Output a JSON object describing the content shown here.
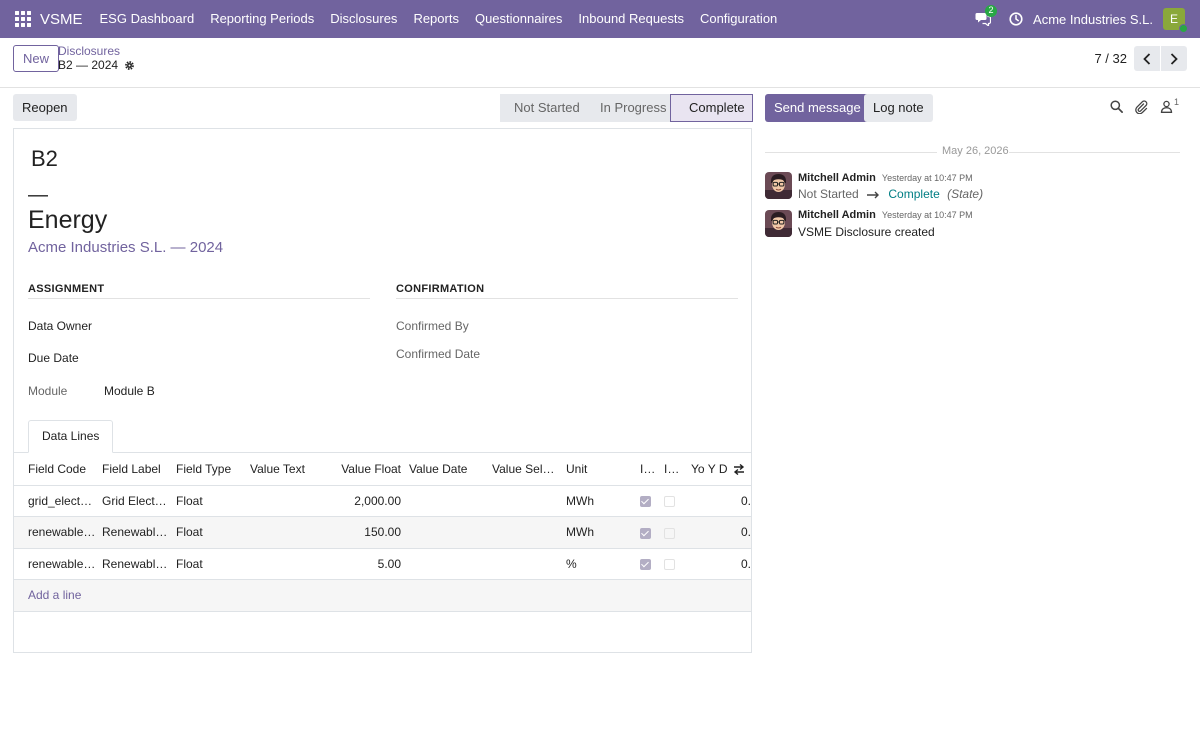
{
  "navbar": {
    "brand": "VSME",
    "menu": [
      "ESG Dashboard",
      "Reporting Periods",
      "Disclosures",
      "Reports",
      "Questionnaires",
      "Inbound Requests",
      "Configuration"
    ],
    "chat_badge": "2",
    "company": "Acme Industries S.L.",
    "avatar_initial": "E",
    "colors": {
      "navbar_bg": "#71639e",
      "online": "#28a745"
    }
  },
  "control": {
    "new_label": "New",
    "breadcrumb_parent": "Disclosures",
    "breadcrumb_current": "B2 — 2024",
    "pager_value": "7 / 32"
  },
  "actions": {
    "reopen_label": "Reopen",
    "stages": [
      "Not Started",
      "In Progress",
      "Complete"
    ],
    "active_stage": "Complete"
  },
  "form": {
    "record_name": "B2",
    "dash": "—",
    "title": "Energy",
    "subtitle": "Acme Industries S.L. — 2024",
    "assignment_title": "ASSIGNMENT",
    "confirmation_title": "CONFIRMATION",
    "data_owner_label": "Data Owner",
    "due_date_label": "Due Date",
    "module_label": "Module",
    "module_value": "Module B",
    "confirmed_by_label": "Confirmed By",
    "confirmed_date_label": "Confirmed Date",
    "tab_label": "Data Lines",
    "columns": [
      "Field Code",
      "Field Label",
      "Field Type",
      "Value Text",
      "Value Float",
      "Value Date",
      "Value Sel…",
      "Unit",
      "I…",
      "I…",
      "Yo Y D"
    ],
    "rows": [
      {
        "code": "grid_elect…",
        "label": "Grid Elect…",
        "type": "Float",
        "value_float": "2,000.00",
        "unit": "MWh",
        "c1": true,
        "c2": false,
        "yoy": "0."
      },
      {
        "code": "renewable…",
        "label": "Renewabl…",
        "type": "Float",
        "value_float": "150.00",
        "unit": "MWh",
        "c1": true,
        "c2": false,
        "yoy": "0."
      },
      {
        "code": "renewable…",
        "label": "Renewabl…",
        "type": "Float",
        "value_float": "5.00",
        "unit": "%",
        "c1": true,
        "c2": false,
        "yoy": "0."
      }
    ],
    "add_line": "Add a line"
  },
  "chatter": {
    "send_label": "Send message",
    "log_label": "Log note",
    "follower_count": "1",
    "date_separator": "May 26, 2026",
    "messages": [
      {
        "author": "Mitchell Admin",
        "time": "Yesterday at 10:47 PM",
        "old_value": "Not Started",
        "new_value": "Complete",
        "field": "(State)"
      },
      {
        "author": "Mitchell Admin",
        "time": "Yesterday at 10:47 PM",
        "body": "VSME Disclosure created"
      }
    ]
  }
}
